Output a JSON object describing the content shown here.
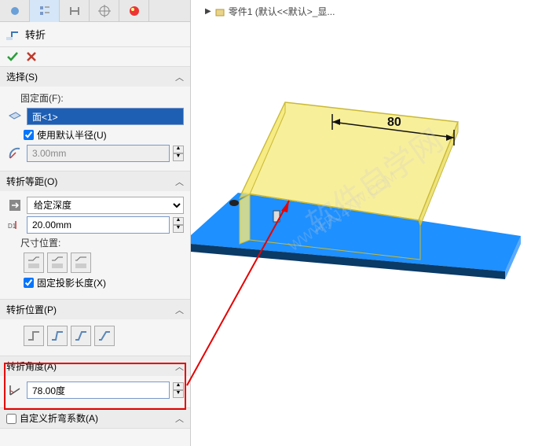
{
  "viewport_title": "零件1  (默认<<默认>_显...",
  "feature": {
    "title": "转折"
  },
  "sections": {
    "select": {
      "title": "选择(S)",
      "fixed_face_label": "固定面(F):",
      "face_value": "面<1>",
      "use_default_radius_label": "使用默认半径(U)",
      "radius_value": "3.00mm"
    },
    "offset": {
      "title": "转折等距(O)",
      "depth_type": "给定深度",
      "depth_value": "20.00mm",
      "dim_pos_label": "尺寸位置:",
      "fix_projection_label": "固定投影长度(X)"
    },
    "position": {
      "title": "转折位置(P)"
    },
    "angle": {
      "title": "转折角度(A)",
      "angle_value": "78.00度"
    },
    "custom": {
      "title": "自定义折弯系数(A)"
    }
  },
  "dimension_label": "80"
}
